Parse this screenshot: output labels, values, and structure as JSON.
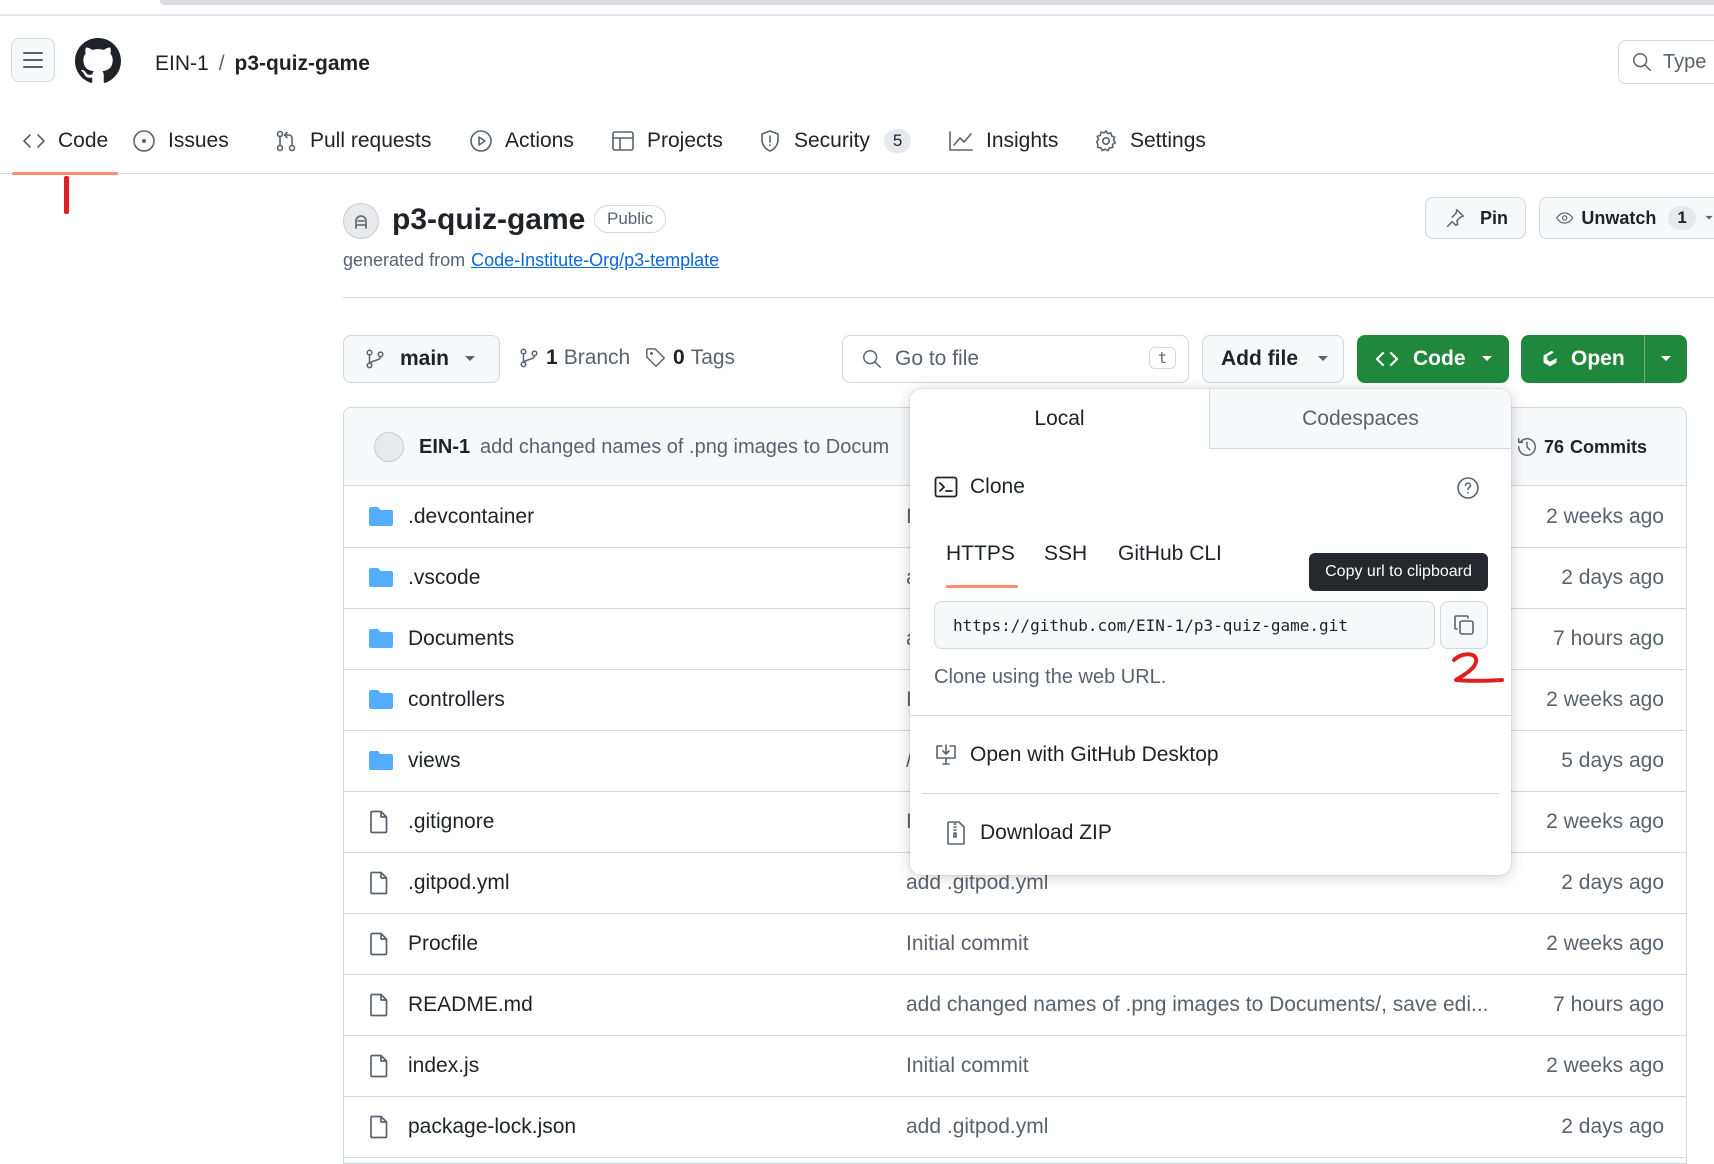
{
  "header": {
    "owner": "EIN-1",
    "separator": "/",
    "repo": "p3-quiz-game",
    "search_placeholder": "Type"
  },
  "nav": {
    "tabs": [
      {
        "label": "Code",
        "icon": "code-icon"
      },
      {
        "label": "Issues",
        "icon": "issue-icon"
      },
      {
        "label": "Pull requests",
        "icon": "pull-request-icon"
      },
      {
        "label": "Actions",
        "icon": "play-icon"
      },
      {
        "label": "Projects",
        "icon": "table-icon"
      },
      {
        "label": "Security",
        "icon": "shield-icon",
        "count": "5"
      },
      {
        "label": "Insights",
        "icon": "graph-icon"
      },
      {
        "label": "Settings",
        "icon": "gear-icon"
      }
    ]
  },
  "repo": {
    "title": "p3-quiz-game",
    "visibility": "Public",
    "generated_prefix": "generated from",
    "template_link": "Code-Institute-Org/p3-template",
    "pin_label": "Pin",
    "unwatch_label": "Unwatch",
    "watch_count": "1"
  },
  "toolbar": {
    "branch": "main",
    "branches_count": "1",
    "branches_label": "Branch",
    "tags_count": "0",
    "tags_label": "Tags",
    "goto_placeholder": "Go to file",
    "goto_shortcut": "t",
    "add_file": "Add file",
    "code": "Code",
    "open": "Open"
  },
  "latest_commit": {
    "author": "EIN-1",
    "message": "add changed names of .png images to Docum",
    "commits_count": "76",
    "commits_label": "Commits"
  },
  "files": [
    {
      "name": ".devcontainer",
      "type": "folder",
      "message": "I",
      "date": "2 weeks ago"
    },
    {
      "name": ".vscode",
      "type": "folder",
      "message": "a",
      "date": "2 days ago"
    },
    {
      "name": "Documents",
      "type": "folder",
      "message": "a",
      "date": "7 hours ago"
    },
    {
      "name": "controllers",
      "type": "folder",
      "message": "I",
      "date": "2 weeks ago"
    },
    {
      "name": "views",
      "type": "folder",
      "message": "/",
      "date": "5 days ago"
    },
    {
      "name": ".gitignore",
      "type": "file",
      "message": "I",
      "date": "2 weeks ago"
    },
    {
      "name": ".gitpod.yml",
      "type": "file",
      "message": "add .gitpod.yml",
      "date": "2 days ago"
    },
    {
      "name": "Procfile",
      "type": "file",
      "message": "Initial commit",
      "date": "2 weeks ago"
    },
    {
      "name": "README.md",
      "type": "file",
      "message": "add changed names of .png images to Documents/, save edi...",
      "date": "7 hours ago"
    },
    {
      "name": "index.js",
      "type": "file",
      "message": "Initial commit",
      "date": "2 weeks ago"
    },
    {
      "name": "package-lock.json",
      "type": "file",
      "message": "add .gitpod.yml",
      "date": "2 days ago"
    }
  ],
  "clone_panel": {
    "tab_local": "Local",
    "tab_codespaces": "Codespaces",
    "heading": "Clone",
    "protocols": [
      "HTTPS",
      "SSH",
      "GitHub CLI"
    ],
    "selected_protocol": "HTTPS",
    "url": "https://github.com/EIN-1/p3-quiz-game.git",
    "tooltip": "Copy url to clipboard",
    "help_text": "Clone using the web URL.",
    "open_desktop": "Open with GitHub Desktop",
    "download_zip": "Download ZIP"
  },
  "annotations": {
    "mark_1": "1",
    "mark_2": "2",
    "color": "#e02020"
  },
  "colors": {
    "accent_green": "#1f883d",
    "tab_underline": "#fd8c73",
    "link_blue": "#0969da",
    "folder_blue": "#54aeff"
  }
}
